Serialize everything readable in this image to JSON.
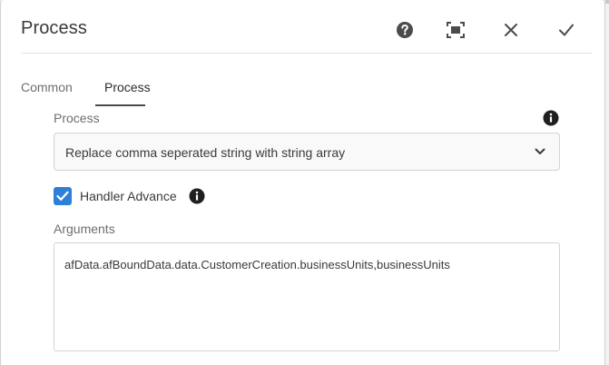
{
  "dialog": {
    "title": "Process",
    "header_buttons": [
      {
        "name": "help",
        "icon": "help-icon"
      },
      {
        "name": "fullscreen",
        "icon": "fullscreen-icon"
      },
      {
        "name": "close",
        "icon": "close-icon"
      },
      {
        "name": "done",
        "icon": "checkmark-icon"
      }
    ]
  },
  "tabs": [
    {
      "label": "Common",
      "active": false
    },
    {
      "label": "Process",
      "active": true
    }
  ],
  "form": {
    "process_label": "Process",
    "process_value": "Replace comma seperated string with string array",
    "handler_advance_label": "Handler Advance",
    "handler_advance_checked": true,
    "arguments_label": "Arguments",
    "arguments_value": "afData.afBoundData.data.CustomerCreation.businessUnits,businessUnits"
  },
  "colors": {
    "accent": "#2d80d8",
    "text": "#323232",
    "muted_text": "#6e6e6e",
    "border": "#d3d3d3"
  }
}
